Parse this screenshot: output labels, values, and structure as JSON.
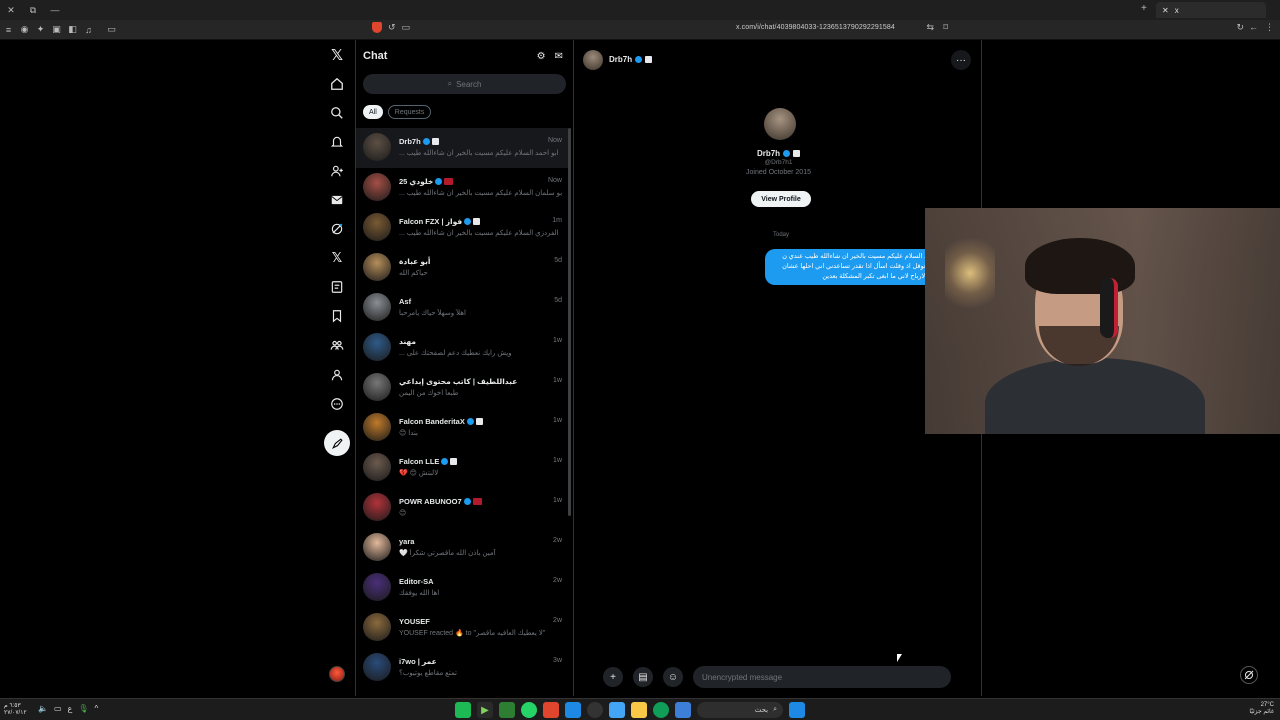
{
  "browser": {
    "url": "x.com/i/chat/4039804033-1236513790292291584",
    "tab_close": "x",
    "tab_plus": "+"
  },
  "chat_list": {
    "title": "Chat",
    "search_placeholder": "Search",
    "filters": [
      "All",
      "Requests"
    ],
    "rows": [
      {
        "name": "Drb7h",
        "time": "Now",
        "preview": "... ابو احمد السلام عليكم مسيت بالخير ان شاءالله طيب",
        "badge": "white",
        "avatar": "#5d5045"
      },
      {
        "name": "خلودي 25",
        "time": "Now",
        "preview": "... بو سلمان السلام عليكم مسيت بالخير ان شاءالله طيب",
        "badge": "red",
        "avatar": "#a44f45"
      },
      {
        "name": "Falcon FZX | فواز",
        "time": "1m",
        "preview": "... الفردزي السلام عليكم مسيت بالخير ان شاءالله طيب",
        "badge": "white",
        "avatar": "#7a5a33"
      },
      {
        "name": "أبو عبادة",
        "time": "5d",
        "preview": "حياكم الله",
        "badge": "",
        "avatar": "#b58e5a"
      },
      {
        "name": "Asf",
        "time": "5d",
        "preview": "اهلاً وسهلاً حياك يامرحبا",
        "badge": "",
        "avatar": "#8a8f95"
      },
      {
        "name": "مهند",
        "time": "1w",
        "preview": "... ويش رايك نعطيك دعم لصفحتك على",
        "badge": "",
        "avatar": "#2f5b8a"
      },
      {
        "name": "عبداللطيف | كاتب محتوى إبداعي",
        "time": "1w",
        "preview": "طبعاً اخوك من اليمن",
        "badge": "",
        "avatar": "#777"
      },
      {
        "name": "Falcon BanderitaX",
        "time": "1w",
        "preview": "😊 بندا",
        "badge": "white",
        "avatar": "#c07a2a"
      },
      {
        "name": "Falcon LLE",
        "time": "1w",
        "preview": "💔 😊 لالبتش",
        "badge": "white",
        "avatar": "#6b5a4e"
      },
      {
        "name": "POWR ABUNOO7",
        "time": "1w",
        "preview": "😊",
        "badge": "red",
        "avatar": "#b2333a"
      },
      {
        "name": "yara",
        "time": "2w",
        "preview": "🤍 آمين باذن الله ماقصرتي شكراً",
        "badge": "",
        "avatar": "#e2b89a"
      },
      {
        "name": "Editor-SA",
        "time": "2w",
        "preview": "اها الله يوفقك",
        "badge": "",
        "avatar": "#4a2f7a"
      },
      {
        "name": "YOUSEF",
        "time": "2w",
        "preview": "YOUSEF reacted 🔥 to \"لا يعطيك العافيه ماقصر\"",
        "badge": "",
        "avatar": "#8b6a3e"
      },
      {
        "name": "i7wo | عمر",
        "time": "3w",
        "preview": "تمتع مقاطع يوتيوب؟",
        "badge": "",
        "avatar": "#2a4b7a"
      }
    ]
  },
  "conversation": {
    "name": "Drb7h",
    "handle": "@Drb7h1",
    "joined": "Joined October 2015",
    "view_profile": "View Profile",
    "date_divider": "Today",
    "message": "د السلام عليكم مسيت بالخير ان شاءالله طيب عندي ن قوقل اذ وقلت اسأل اذا تقدر تساعدني اني احلها عشان الارباح لاني ما ابغى تكبر المشكلة بعدين",
    "input_placeholder": "Unencrypted message",
    "more": "···"
  },
  "taskbar": {
    "time": "٦:٥٣ م",
    "date": "٢٧/٠٧/١٢",
    "lang": "ع",
    "search_label": "بحث",
    "weather_temp": "27°C",
    "weather_label": "غائم جزئيًا"
  },
  "colors": {
    "accent": "#1d9bf0",
    "background": "#000000",
    "border": "#2f3336"
  }
}
